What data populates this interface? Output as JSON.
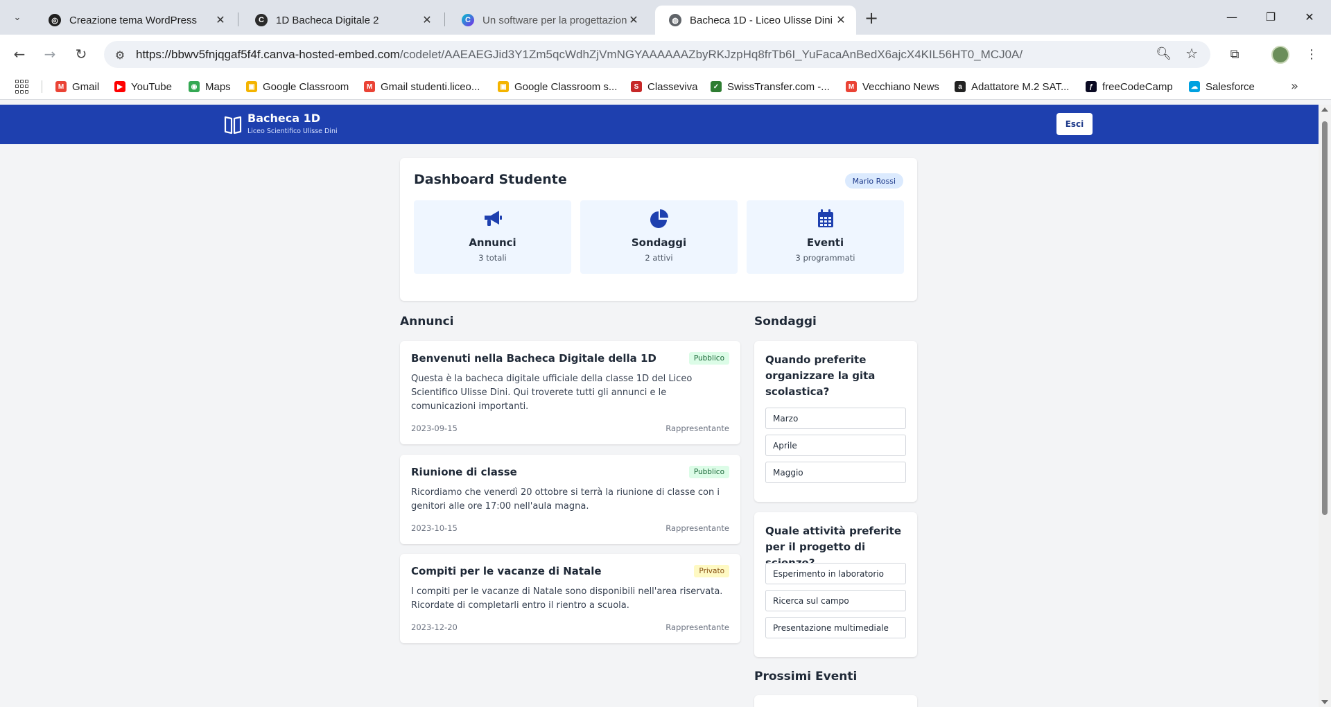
{
  "browser": {
    "tabs": [
      {
        "title": "Creazione tema WordPress",
        "icon": "chatgpt-icon",
        "active": false
      },
      {
        "title": "1D Bacheca Digitale 2",
        "icon": "claude-icon",
        "active": false
      },
      {
        "title": "Un software per la progettazione",
        "icon": "canva-icon",
        "active": false
      },
      {
        "title": "Bacheca 1D - Liceo Ulisse Dini",
        "icon": "globe-icon",
        "active": true
      }
    ],
    "url_host": "https://bbwv5fnjqgaf5f4f.canva-hosted-embed.com",
    "url_path": "/codelet/AAEAEGJid3Y1Zm5qcWdhZjVmNGYAAAAAAZbyRKJzpHq8frTb6I_YuFacaAnBedX6ajcX4KIL56HT0_MCJ0A/",
    "bookmarks": [
      {
        "label": "Gmail",
        "icon": "gmail-icon",
        "color": "#ea4335"
      },
      {
        "label": "YouTube",
        "icon": "youtube-icon",
        "color": "#ff0000"
      },
      {
        "label": "Maps",
        "icon": "maps-icon",
        "color": "#34a853"
      },
      {
        "label": "Google Classroom",
        "icon": "classroom-icon",
        "color": "#f4b400"
      },
      {
        "label": "Gmail studenti.liceo...",
        "icon": "gmail-icon",
        "color": "#ea4335"
      },
      {
        "label": "Google Classroom s...",
        "icon": "classroom-icon",
        "color": "#f4b400"
      },
      {
        "label": "Classeviva",
        "icon": "classeviva-icon",
        "color": "#c62828"
      },
      {
        "label": "SwissTransfer.com -...",
        "icon": "swisstransfer-icon",
        "color": "#2e7d32"
      },
      {
        "label": "Vecchiano News",
        "icon": "gmail-icon",
        "color": "#ea4335"
      },
      {
        "label": "Adattatore M.2 SAT...",
        "icon": "amazon-icon",
        "color": "#222222"
      },
      {
        "label": "freeCodeCamp",
        "icon": "freecodecamp-icon",
        "color": "#0a0a23"
      },
      {
        "label": "Salesforce",
        "icon": "salesforce-icon",
        "color": "#00a1e0"
      }
    ]
  },
  "header": {
    "title": "Bacheca 1D",
    "subtitle": "Liceo Scientifico Ulisse Dini",
    "logout": "Esci",
    "color": "#1e40af"
  },
  "dashboard": {
    "title": "Dashboard Studente",
    "user": "Mario Rossi",
    "stats": [
      {
        "label": "Annunci",
        "count": "3 totali",
        "icon": "megaphone-icon"
      },
      {
        "label": "Sondaggi",
        "count": "2 attivi",
        "icon": "pie-chart-icon"
      },
      {
        "label": "Eventi",
        "count": "3 programmati",
        "icon": "calendar-icon"
      }
    ]
  },
  "announcements": {
    "section_title": "Annunci",
    "items": [
      {
        "title": "Benvenuti nella Bacheca Digitale della 1D",
        "badge": "Pubblico",
        "body": "Questa è la bacheca digitale ufficiale della classe 1D del Liceo Scientifico Ulisse Dini. Qui troverete tutti gli annunci e le comunicazioni importanti.",
        "date": "2023-09-15",
        "author": "Rappresentante"
      },
      {
        "title": "Riunione di classe",
        "badge": "Pubblico",
        "body": "Ricordiamo che venerdì 20 ottobre si terrà la riunione di classe con i genitori alle ore 17:00 nell'aula magna.",
        "date": "2023-10-15",
        "author": "Rappresentante"
      },
      {
        "title": "Compiti per le vacanze di Natale",
        "badge": "Privato",
        "body": "I compiti per le vacanze di Natale sono disponibili nell'area riservata. Ricordate di completarli entro il rientro a scuola.",
        "date": "2023-12-20",
        "author": "Rappresentante"
      }
    ]
  },
  "polls": {
    "section_title": "Sondaggi",
    "items": [
      {
        "question": "Quando preferite organizzare la gita scolastica?",
        "options": [
          "Marzo",
          "Aprile",
          "Maggio"
        ]
      },
      {
        "question": "Quale attività preferite per il progetto di scienze?",
        "options": [
          "Esperimento in laboratorio",
          "Ricerca sul campo",
          "Presentazione multimediale"
        ]
      }
    ]
  },
  "events": {
    "section_title": "Prossimi Eventi"
  }
}
